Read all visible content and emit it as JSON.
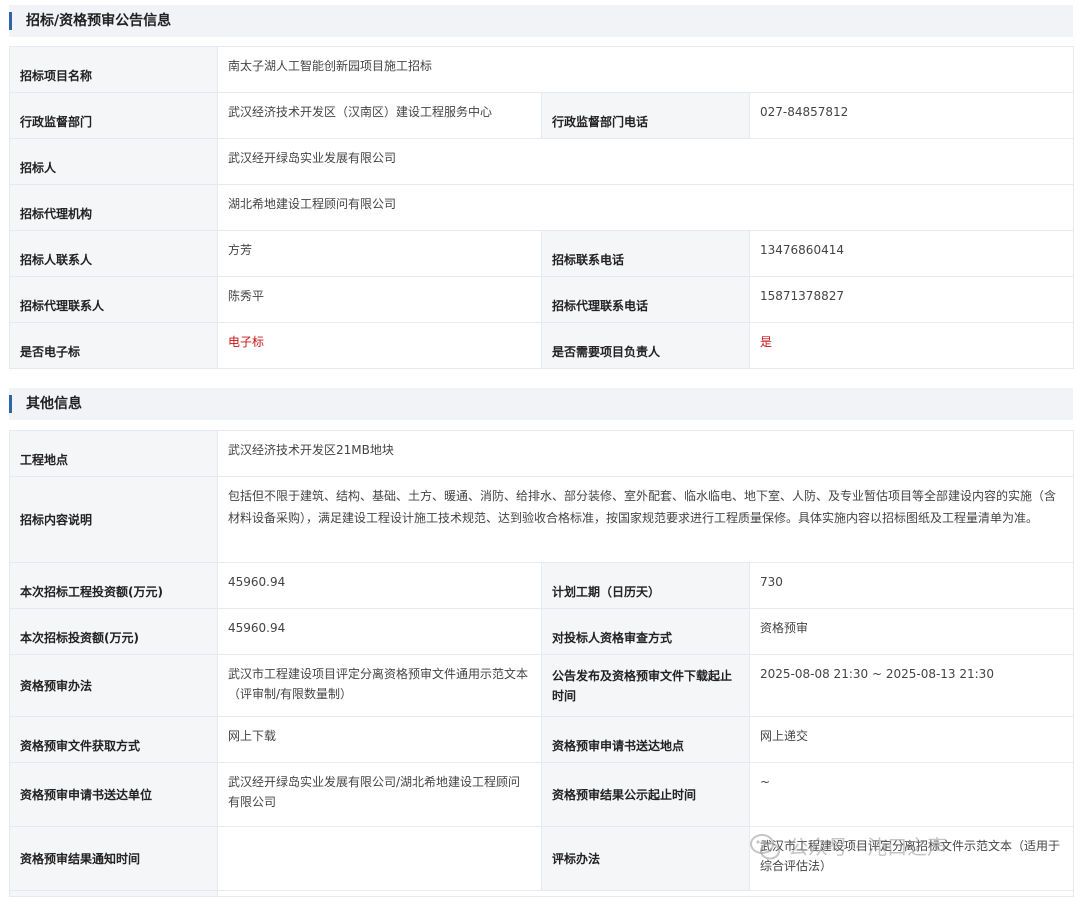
{
  "section1": {
    "title": "招标/资格预审公告信息",
    "rows": [
      {
        "label": "招标项目名称",
        "value": "南太子湖人工智能创新园项目施工招标"
      },
      {
        "label": "行政监督部门",
        "value": "武汉经济技术开发区（汉南区）建设工程服务中心",
        "label2": "行政监督部门电话",
        "value2": "027-84857812"
      },
      {
        "label": "招标人",
        "value": "武汉经开绿岛实业发展有限公司"
      },
      {
        "label": "招标代理机构",
        "value": "湖北希地建设工程顾问有限公司"
      },
      {
        "label": "招标人联系人",
        "value": "方芳",
        "label2": "招标联系电话",
        "value2": "13476860414"
      },
      {
        "label": "招标代理联系人",
        "value": "陈秀平",
        "label2": "招标代理联系电话",
        "value2": "15871378827"
      },
      {
        "label": "是否电子标",
        "value": "电子标",
        "label2": "是否需要项目负责人",
        "value2": "是"
      }
    ]
  },
  "section2": {
    "title": "其他信息",
    "rows": [
      {
        "label": "工程地点",
        "value": "武汉经济技术开发区21MB地块"
      },
      {
        "label": "招标内容说明",
        "value": "包括但不限于建筑、结构、基础、土方、暖通、消防、给排水、部分装修、室外配套、临水临电、地下室、人防、及专业暂估项目等全部建设内容的实施（含材料设备采购），满足建设工程设计施工技术规范、达到验收合格标准，按国家规范要求进行工程质量保修。具体实施内容以招标图纸及工程量清单为准。"
      },
      {
        "label": "本次招标工程投资额(万元)",
        "value": "45960.94",
        "label2": "计划工期（日历天）",
        "value2": "730"
      },
      {
        "label": "本次招标投资额(万元)",
        "value": "45960.94",
        "label2": "对投标人资格审查方式",
        "value2": "资格预审"
      },
      {
        "label": "资格预审办法",
        "value": "武汉市工程建设项目评定分离资格预审文件通用示范文本（评审制/有限数量制）",
        "label2": "公告发布及资格预审文件下载起止时间",
        "value2": "2025-08-08 21:30 ~ 2025-08-13 21:30"
      },
      {
        "label": "资格预审文件获取方式",
        "value": "网上下载",
        "label2": "资格预审申请书送达地点",
        "value2": "网上递交"
      },
      {
        "label": "资格预审申请书送达单位",
        "value": "武汉经开绿岛实业发展有限公司/湖北希地建设工程顾问有限公司",
        "label2": "资格预审结果公示起止时间",
        "value2": "~"
      },
      {
        "label": "资格预审结果通知时间",
        "value": "",
        "label2": "评标办法",
        "value2": "武汉市工程建设项目评定分离招标文件示范文本（适用于综合评估法）"
      }
    ]
  },
  "watermark": {
    "text": "公众号 · 沌口之声"
  }
}
